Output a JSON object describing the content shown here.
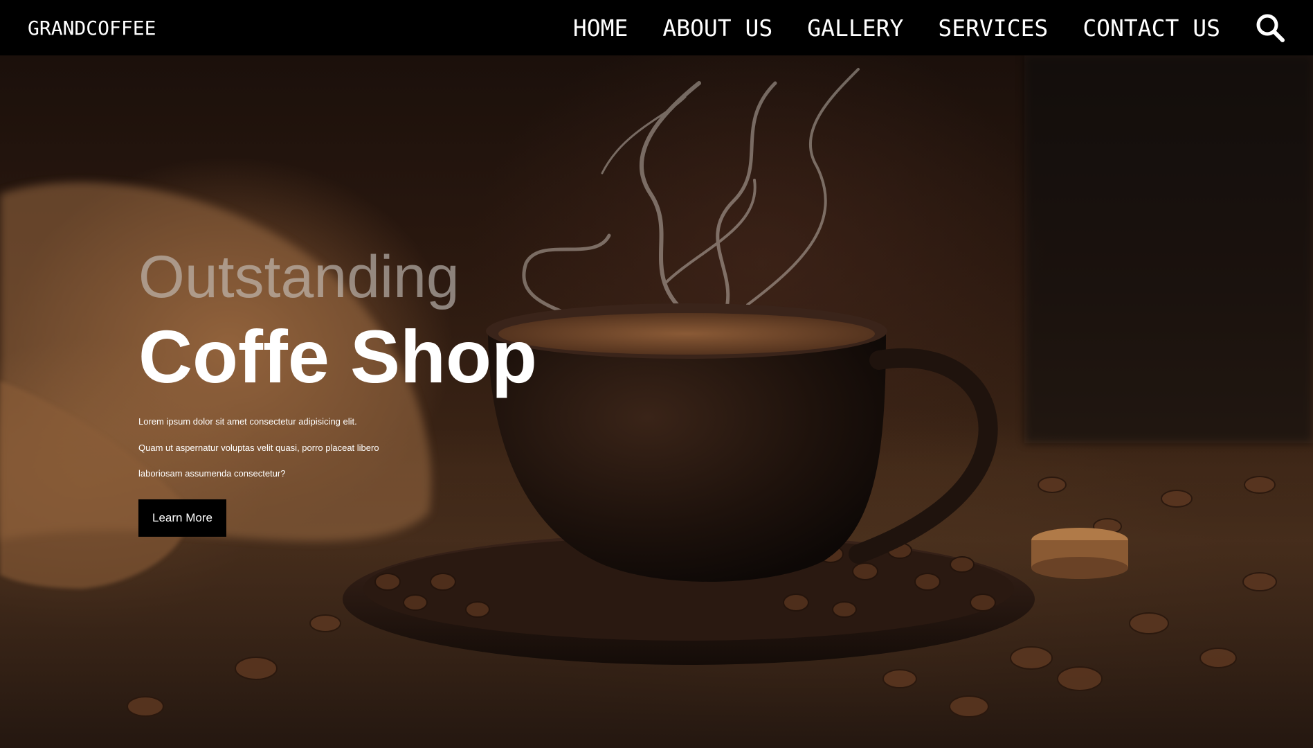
{
  "brand": {
    "logo": "GRANDCOFFEE"
  },
  "nav": {
    "items": [
      {
        "label": "HOME"
      },
      {
        "label": "ABOUT US"
      },
      {
        "label": "GALLERY"
      },
      {
        "label": "SERVICES"
      },
      {
        "label": "CONTACT US"
      }
    ],
    "search_icon": "search-icon"
  },
  "hero": {
    "subtitle": "Outstanding",
    "title": "Coffe Shop",
    "lines": [
      "Lorem ipsum dolor sit amet consectetur adipisicing elit.",
      "Quam ut aspernatur voluptas velit quasi, porro placeat libero",
      "laboriosam assumenda consectetur?"
    ],
    "cta_label": "Learn More"
  },
  "colors": {
    "nav_bg": "#000000",
    "text": "#ffffff",
    "subtitle": "#c8c3be",
    "cta_bg": "#000000"
  }
}
